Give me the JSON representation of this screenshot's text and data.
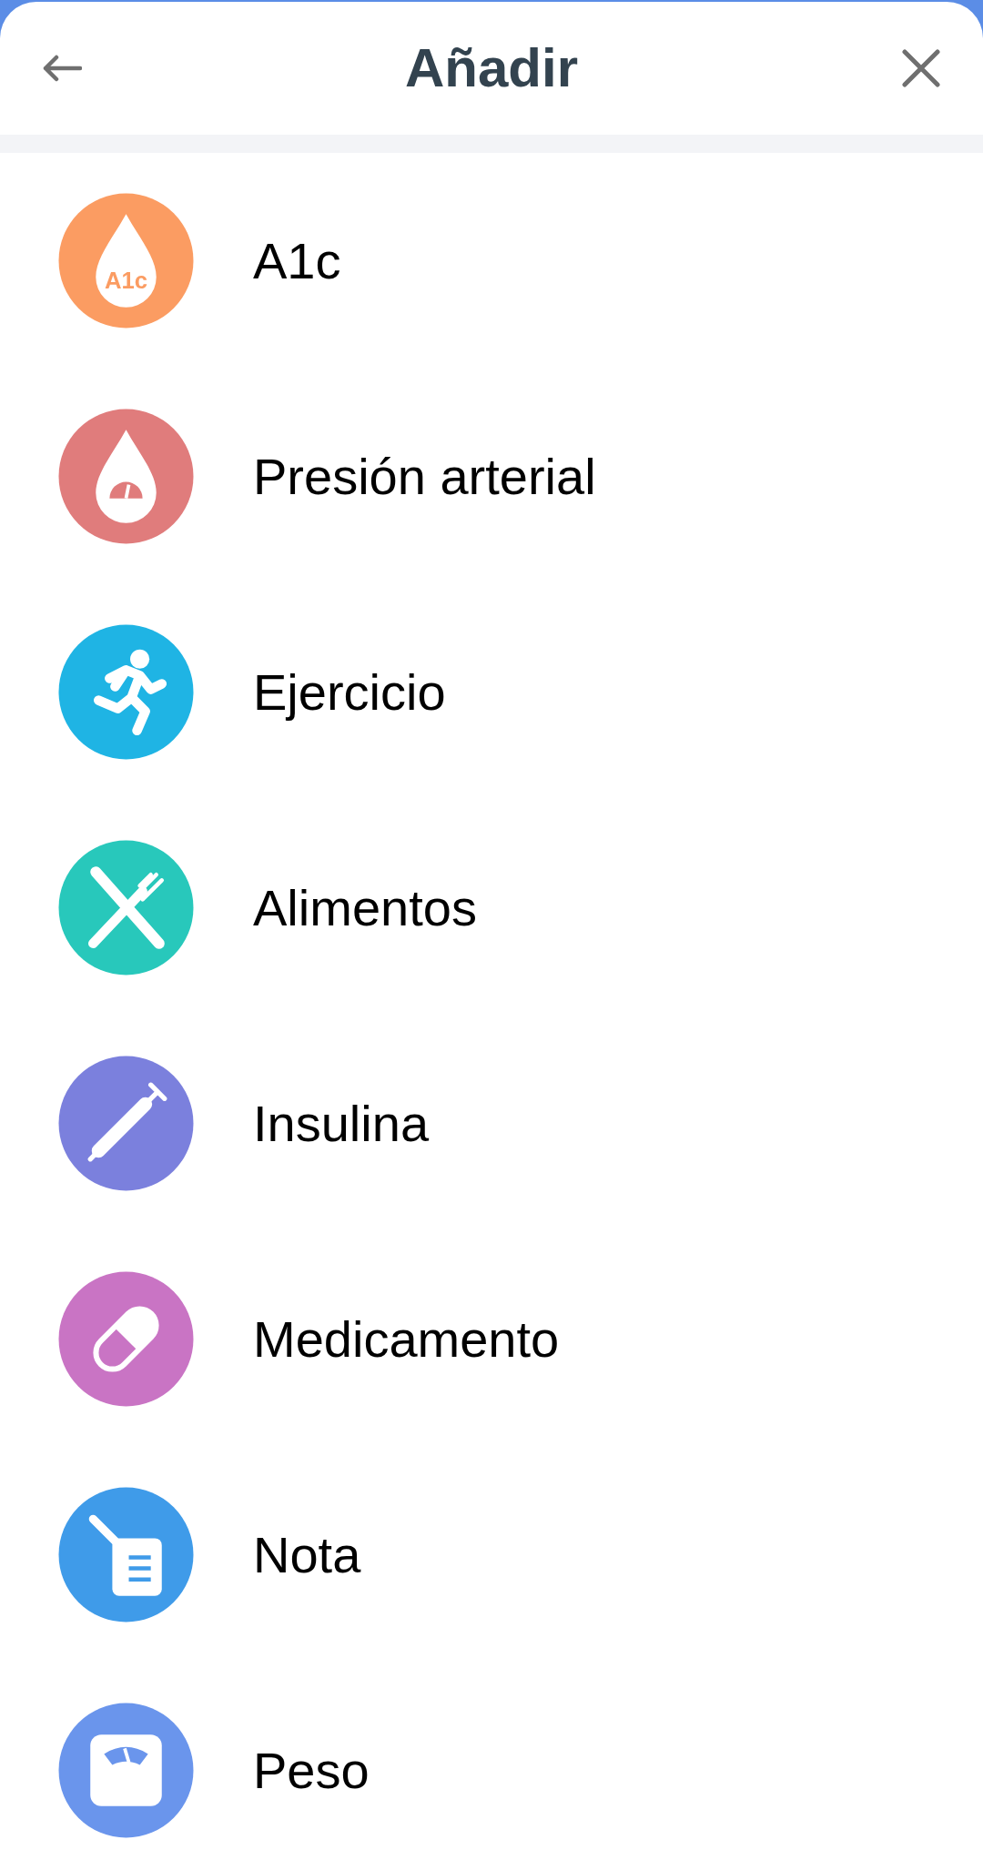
{
  "header": {
    "title": "Añadir"
  },
  "items": [
    {
      "label": "A1c",
      "kind": "a1c",
      "icon_text": "A1c",
      "color": "#fb9c62"
    },
    {
      "label": "Presión arterial",
      "kind": "pressure",
      "color": "#e07c7c"
    },
    {
      "label": "Ejercicio",
      "kind": "exercise",
      "color": "#1fb4e4"
    },
    {
      "label": "Alimentos",
      "kind": "food",
      "color": "#28c8bb"
    },
    {
      "label": "Insulina",
      "kind": "insulin",
      "color": "#7b80dd"
    },
    {
      "label": "Medicamento",
      "kind": "medication",
      "color": "#c974c4"
    },
    {
      "label": "Nota",
      "kind": "note",
      "color": "#3f9be9"
    },
    {
      "label": "Peso",
      "kind": "weight",
      "color": "#6a95ec"
    }
  ]
}
